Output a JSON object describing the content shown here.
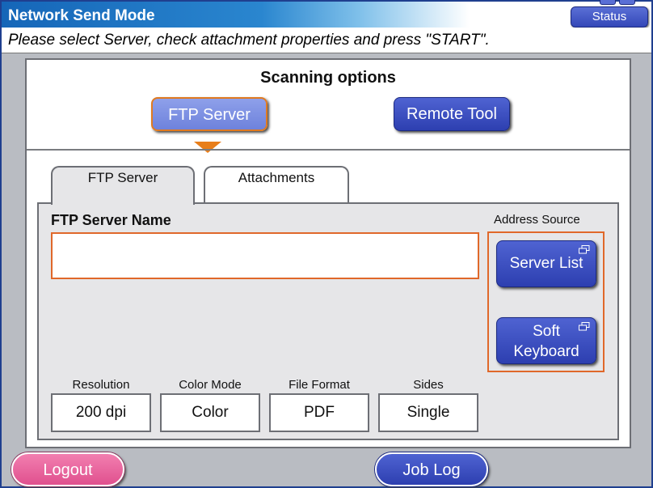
{
  "window": {
    "title": "Network Send Mode",
    "status_label": "Status",
    "instruction": "Please select Server, check attachment properties and press \"START\"."
  },
  "scanning_options": {
    "title": "Scanning options",
    "buttons": [
      {
        "label": "FTP Server",
        "selected": true
      },
      {
        "label": "Remote Tool",
        "selected": false
      }
    ]
  },
  "tabs": [
    {
      "label": "FTP Server",
      "active": true
    },
    {
      "label": "Attachments",
      "active": false
    }
  ],
  "ftp_panel": {
    "server_name_label": "FTP Server Name",
    "server_name_value": "",
    "address_source": {
      "label": "Address Source",
      "server_list_label": "Server List",
      "soft_keyboard_line1": "Soft",
      "soft_keyboard_line2": "Keyboard"
    }
  },
  "attachment_props": [
    {
      "label": "Resolution",
      "value": "200 dpi"
    },
    {
      "label": "Color Mode",
      "value": "Color"
    },
    {
      "label": "File Format",
      "value": "PDF"
    },
    {
      "label": "Sides",
      "value": "Single"
    }
  ],
  "footer": {
    "logout_label": "Logout",
    "job_log_label": "Job Log"
  },
  "colors": {
    "title_bar": "#1566b8",
    "button_blue": "#3448b8",
    "highlight_orange": "#e0682a",
    "logout_pink": "#e0508e"
  }
}
